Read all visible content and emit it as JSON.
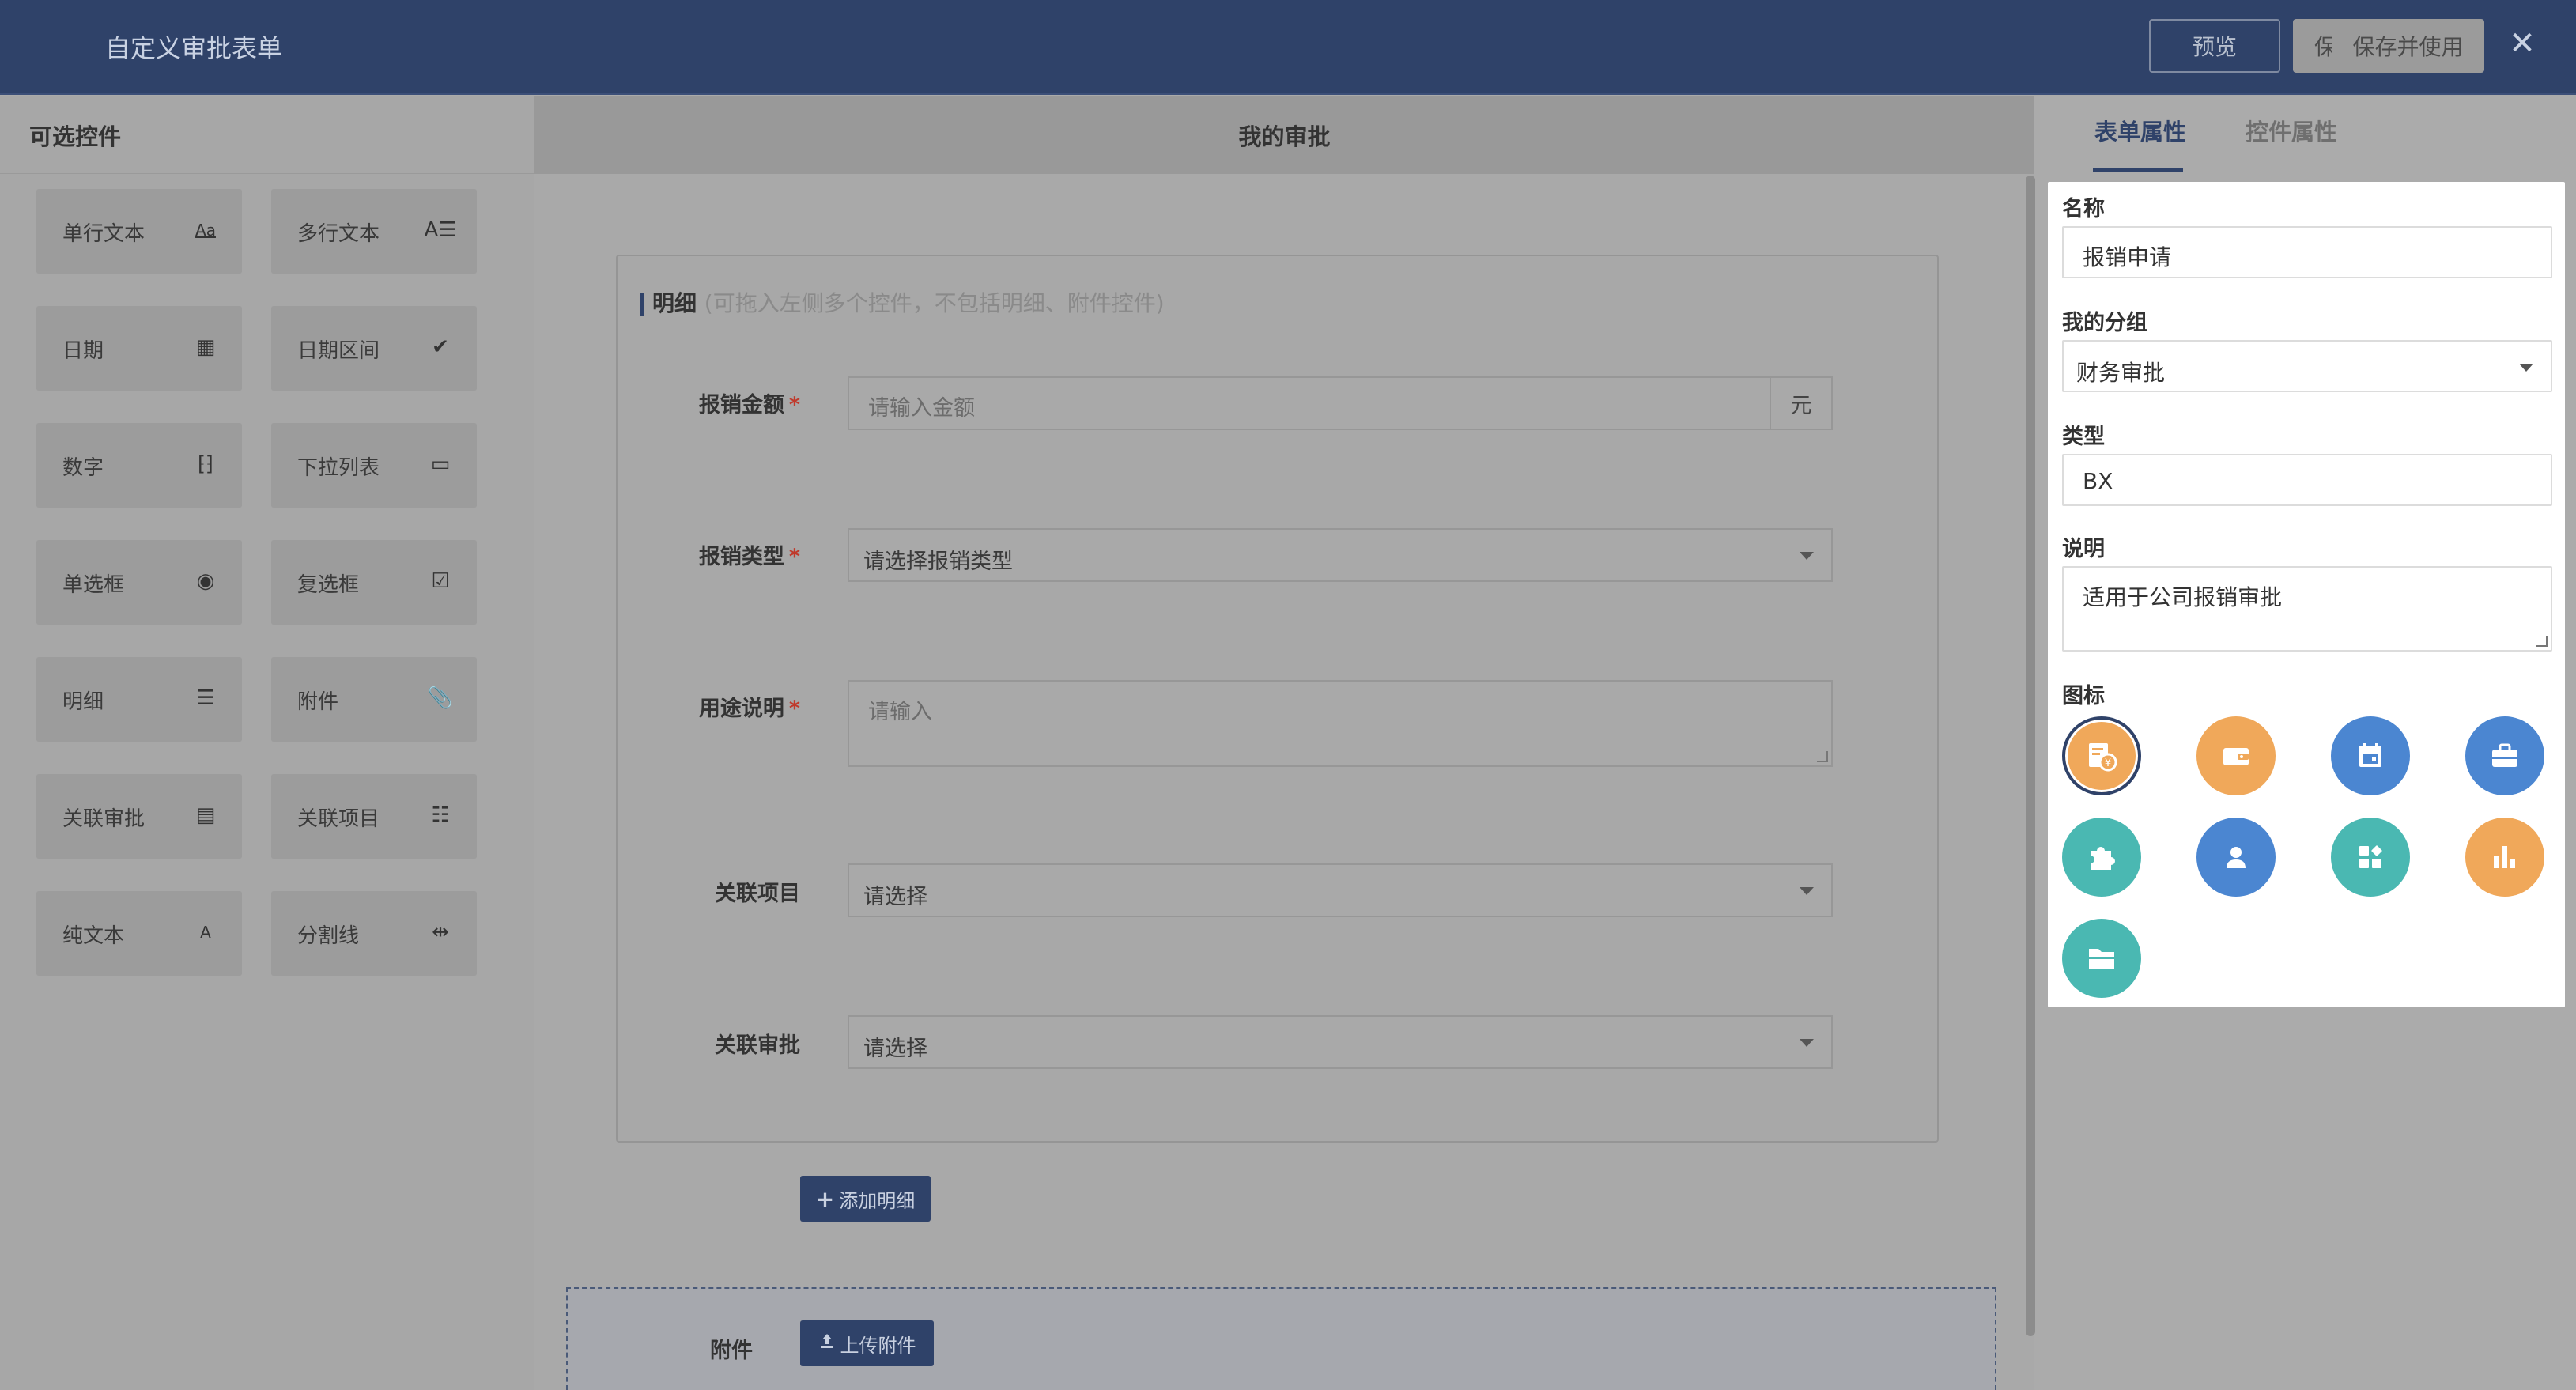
{
  "header": {
    "title": "自定义审批表单",
    "preview_label": "预览",
    "save_label": "保存",
    "save_and_use_label": "保存并使用",
    "close_symbol": "✕"
  },
  "left_panel": {
    "title": "可选控件",
    "controls": [
      {
        "label": "单行文本",
        "icon": "text-aa-icon",
        "glyph": "Aa"
      },
      {
        "label": "多行文本",
        "icon": "multiline-text-icon",
        "glyph": "A☰"
      },
      {
        "label": "日期",
        "icon": "calendar-icon",
        "glyph": "▦"
      },
      {
        "label": "日期区间",
        "icon": "calendar-check-icon",
        "glyph": "✔"
      },
      {
        "label": "数字",
        "icon": "number-icon",
        "glyph": "⁅⁆"
      },
      {
        "label": "下拉列表",
        "icon": "dropdown-icon",
        "glyph": "▭"
      },
      {
        "label": "单选框",
        "icon": "radio-icon",
        "glyph": "◉"
      },
      {
        "label": "复选框",
        "icon": "checkbox-icon",
        "glyph": "☑"
      },
      {
        "label": "明细",
        "icon": "list-icon",
        "glyph": "☰"
      },
      {
        "label": "附件",
        "icon": "paperclip-icon",
        "glyph": "📎"
      },
      {
        "label": "关联审批",
        "icon": "related-approval-icon",
        "glyph": "▤"
      },
      {
        "label": "关联项目",
        "icon": "related-project-icon",
        "glyph": "☷"
      },
      {
        "label": "纯文本",
        "icon": "plain-text-icon",
        "glyph": "A"
      },
      {
        "label": "分割线",
        "icon": "divider-icon",
        "glyph": "⇹"
      }
    ]
  },
  "center": {
    "title": "我的审批",
    "detail_label": "明细",
    "detail_hint": "(可拖入左侧多个控件，不包括明细、附件控件)",
    "fields": [
      {
        "label": "报销金额",
        "required": true,
        "placeholder": "请输入金额",
        "unit": "元"
      },
      {
        "label": "报销类型",
        "required": true,
        "value": "请选择报销类型"
      },
      {
        "label": "用途说明",
        "required": true,
        "placeholder": "请输入"
      },
      {
        "label": "关联项目",
        "required": false,
        "value": "请选择"
      },
      {
        "label": "关联审批",
        "required": false,
        "value": "请选择"
      }
    ],
    "required_mark": "*",
    "add_detail_label": "添加明细",
    "attachment_label": "附件",
    "upload_label": "上传附件"
  },
  "right_panel": {
    "tabs": {
      "form": "表单属性",
      "control": "控件属性"
    },
    "name_label": "名称",
    "name_value": "报销申请",
    "group_label": "我的分组",
    "group_value": "财务审批",
    "type_label": "类型",
    "type_value": "BX",
    "desc_label": "说明",
    "desc_value": "适用于公司报销审批",
    "icon_label": "图标",
    "icons": [
      {
        "name": "expense-icon",
        "color": "#f0a85a",
        "selected": true
      },
      {
        "name": "wallet-icon",
        "color": "#f0a85a"
      },
      {
        "name": "calendar-icon",
        "color": "#4b86d1"
      },
      {
        "name": "briefcase-icon",
        "color": "#4b86d1"
      },
      {
        "name": "puzzle-icon",
        "color": "#4ab8b2"
      },
      {
        "name": "user-icon",
        "color": "#4b86d1"
      },
      {
        "name": "apps-icon",
        "color": "#4ab8b2"
      },
      {
        "name": "bar-chart-icon",
        "color": "#f0a85a"
      },
      {
        "name": "folder-icon",
        "color": "#4ab8b2"
      }
    ]
  }
}
